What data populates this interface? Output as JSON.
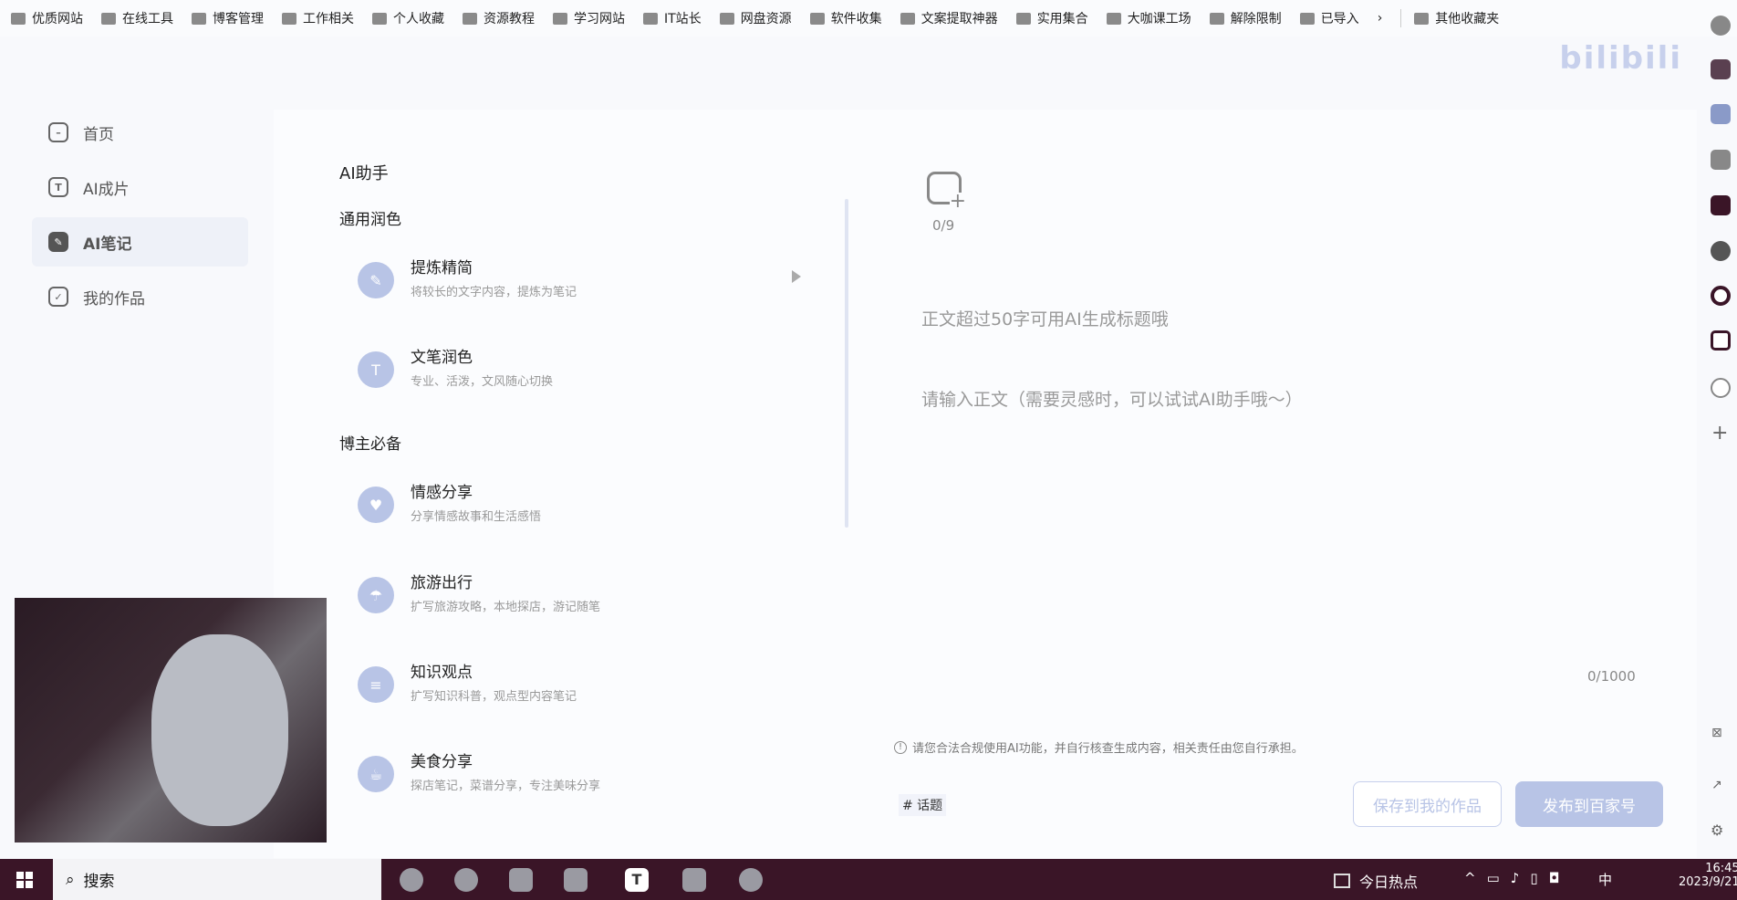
{
  "bookmarks": [
    "优质网站",
    "在线工具",
    "博客管理",
    "工作相关",
    "个人收藏",
    "资源教程",
    "学习网站",
    "IT站长",
    "网盘资源",
    "软件收集",
    "文案提取神器",
    "实用集合",
    "大咖课工场",
    "解除限制",
    "已导入"
  ],
  "bookmarks_more": "其他收藏夹",
  "bookmarks_overflow": "›",
  "watermark": "bilibili",
  "sidebar": [
    {
      "label": "首页",
      "icon": "home-icon",
      "glyph": "–"
    },
    {
      "label": "AI成片",
      "icon": "ai-video-icon",
      "glyph": "T"
    },
    {
      "label": "AI笔记",
      "icon": "ai-note-icon",
      "glyph": "✎",
      "active": true
    },
    {
      "label": "我的作品",
      "icon": "my-works-icon",
      "glyph": "✓"
    }
  ],
  "assistant": {
    "title": "AI助手",
    "groups": [
      {
        "label": "通用润色",
        "items": [
          {
            "title": "提炼精简",
            "desc": "将较长的文字内容，提炼为笔记",
            "icon": "✎"
          },
          {
            "title": "文笔润色",
            "desc": "专业、活泼，文风随心切换",
            "icon": "T"
          }
        ]
      },
      {
        "label": "博主必备",
        "items": [
          {
            "title": "情感分享",
            "desc": "分享情感故事和生活感悟",
            "icon": "♥"
          },
          {
            "title": "旅游出行",
            "desc": "扩写旅游攻略，本地探店，游记随笔",
            "icon": "☂"
          },
          {
            "title": "知识观点",
            "desc": "扩写知识科普，观点型内容笔记",
            "icon": "≡"
          },
          {
            "title": "美食分享",
            "desc": "探店笔记，菜谱分享，专注美味分享",
            "icon": "☕"
          }
        ]
      }
    ]
  },
  "editor": {
    "image_count": "0/9",
    "title_placeholder": "正文超过50字可用AI生成标题哦",
    "body_placeholder": "请输入正文（需要灵感时，可以试试AI助手哦～）",
    "char_count": "0/1000",
    "notice": "请您合法合规使用AI功能，并自行核查生成内容，相关责任由您自行承担。",
    "topic": "# 话题",
    "save_label": "保存到我的作品",
    "publish_label": "发布到百家号"
  },
  "taskbar": {
    "search": "搜索",
    "news": "今日热点",
    "ime": "中",
    "time": "16:45",
    "date": "2023/9/21"
  },
  "colors": {
    "accent": "#b8c4e6",
    "taskbar": "#3a1527"
  }
}
